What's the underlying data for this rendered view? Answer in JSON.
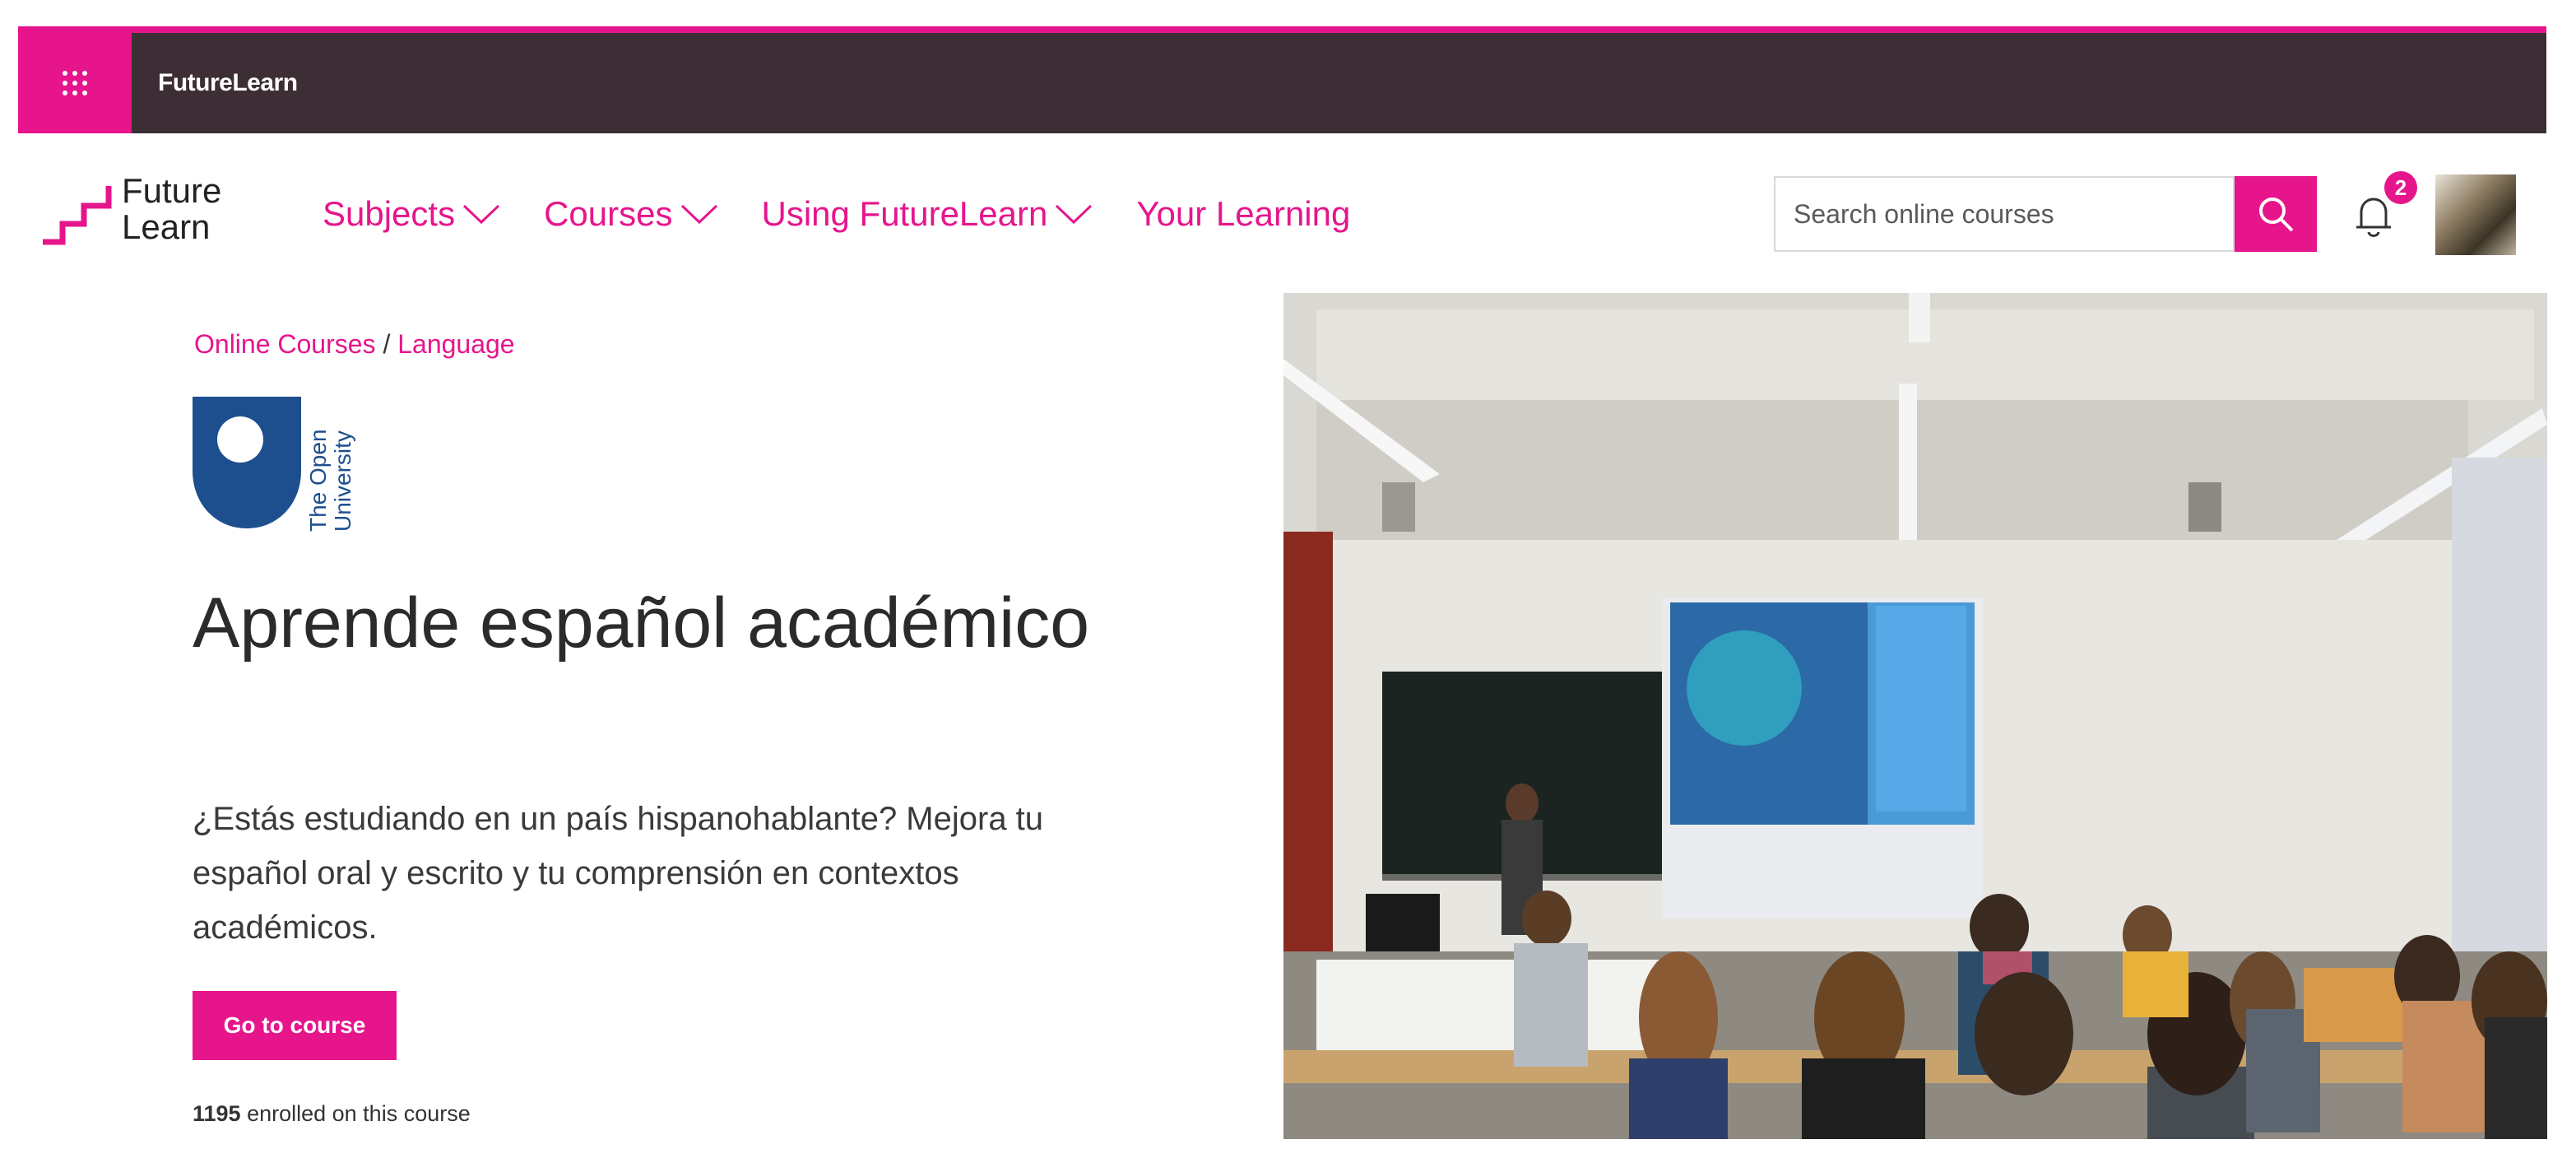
{
  "topbar": {
    "brand": "FutureLearn",
    "apps_icon": "grid-icon"
  },
  "header": {
    "logo_line1": "Future",
    "logo_line2": "Learn",
    "nav": [
      {
        "label": "Subjects",
        "has_dropdown": true
      },
      {
        "label": "Courses",
        "has_dropdown": true
      },
      {
        "label": "Using FutureLearn",
        "has_dropdown": true
      },
      {
        "label": "Your Learning",
        "has_dropdown": false
      }
    ],
    "search_placeholder": "Search online courses",
    "notifications_count": "2"
  },
  "breadcrumb": {
    "item1": "Online Courses",
    "separator": " / ",
    "item2": "Language"
  },
  "partner": {
    "line1": "The Open",
    "line2": "University"
  },
  "course": {
    "title": "Aprende español académico",
    "description": "¿Estás estudiando en un país hispanohablante? Mejora tu español oral y escrito y tu comprensión en contextos académicos.",
    "cta_label": "Go to course",
    "enrolled_count": "1195",
    "enrolled_suffix": " enrolled on this course"
  },
  "colors": {
    "brand_pink": "#e6158c",
    "topbar_bg": "#3d2e36",
    "ou_blue": "#1d4f8e"
  }
}
